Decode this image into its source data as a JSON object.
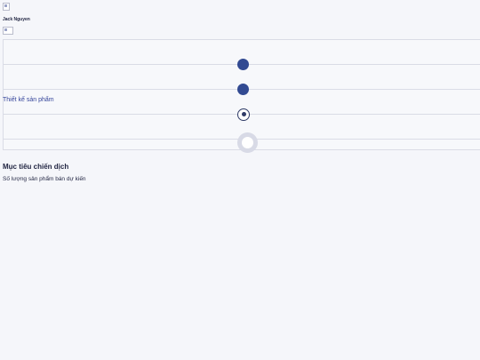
{
  "header": {
    "user_name": "Jack Nguyen"
  },
  "timeline": {
    "active_step_label": "Thiết kế sản phẩm",
    "steps": [
      {
        "status": "completed"
      },
      {
        "status": "completed"
      },
      {
        "status": "current"
      },
      {
        "status": "pending"
      }
    ],
    "colors": {
      "completed": "#324a92",
      "current_ring": "#2e3a66",
      "pending_ring": "#d8dae6",
      "label": "#34449a"
    }
  },
  "campaign": {
    "title": "Mục tiêu chiến dịch",
    "subtitle": "Số lượng sản phẩm bán dự kiến"
  }
}
